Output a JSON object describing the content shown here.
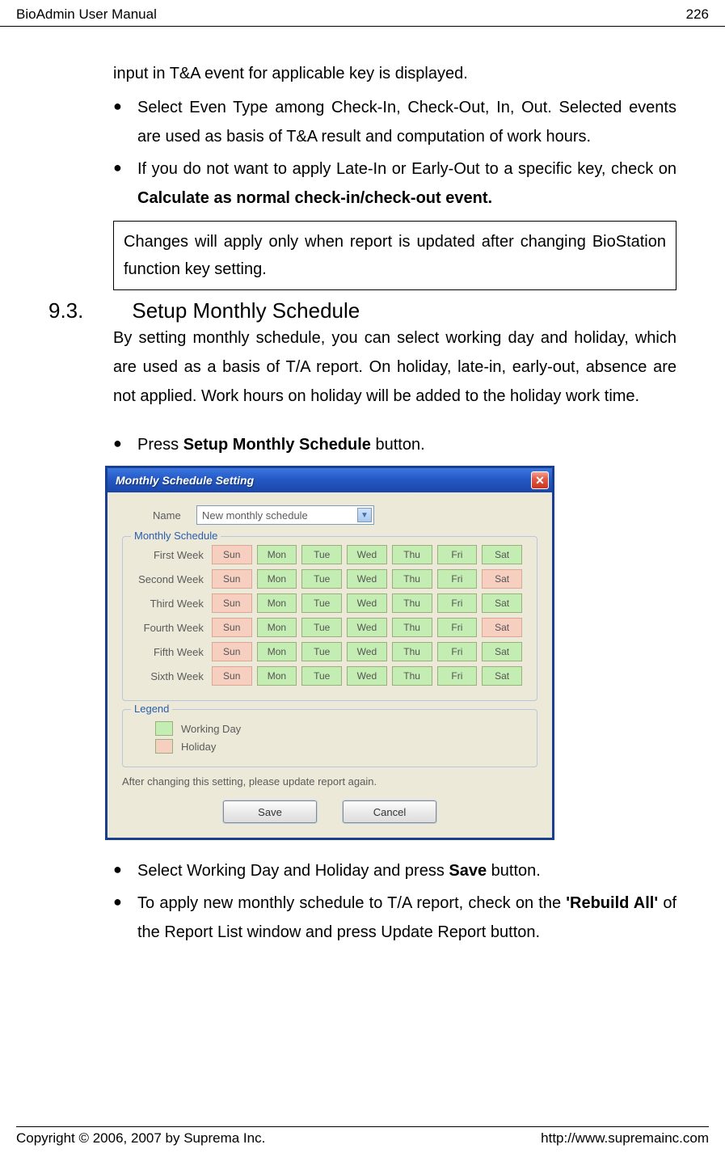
{
  "header": {
    "title": "BioAdmin User Manual",
    "page": "226"
  },
  "intro_text": "input in T&A event for applicable key is displayed.",
  "bullets_top": [
    {
      "text": "Select Even Type among Check-In, Check-Out, In, Out. Selected events are used as basis of T&A result and computation of work hours."
    },
    {
      "pre": "If you do not want to apply Late-In or Early-Out to a specific key, check on ",
      "bold": "Calculate as normal check-in/check-out event."
    }
  ],
  "note": "Changes will apply only when report is updated after changing BioStation function key setting.",
  "section": {
    "num": "9.3.",
    "title": "Setup Monthly Schedule"
  },
  "section_body": "By setting monthly schedule, you can select working day and holiday, which are used as a basis of T/A report. On holiday, late-in, early-out, absence are not applied. Work hours on holiday will be added to the holiday work time.",
  "bullet_press": {
    "pre": "Press ",
    "bold": "Setup Monthly Schedule",
    "post": " button."
  },
  "dialog": {
    "title": "Monthly Schedule Setting",
    "name_label": "Name",
    "combo_value": "New monthly schedule",
    "group_label": "Monthly Schedule",
    "days": [
      "Sun",
      "Mon",
      "Tue",
      "Wed",
      "Thu",
      "Fri",
      "Sat"
    ],
    "weeks": [
      {
        "label": "First Week",
        "pattern": [
          "holiday",
          "working",
          "working",
          "working",
          "working",
          "working",
          "working"
        ]
      },
      {
        "label": "Second Week",
        "pattern": [
          "holiday",
          "working",
          "working",
          "working",
          "working",
          "working",
          "holiday"
        ]
      },
      {
        "label": "Third Week",
        "pattern": [
          "holiday",
          "working",
          "working",
          "working",
          "working",
          "working",
          "working"
        ]
      },
      {
        "label": "Fourth Week",
        "pattern": [
          "holiday",
          "working",
          "working",
          "working",
          "working",
          "working",
          "holiday"
        ]
      },
      {
        "label": "Fifth Week",
        "pattern": [
          "holiday",
          "working",
          "working",
          "working",
          "working",
          "working",
          "working"
        ]
      },
      {
        "label": "Sixth Week",
        "pattern": [
          "holiday",
          "working",
          "working",
          "working",
          "working",
          "working",
          "working"
        ]
      }
    ],
    "legend_label": "Legend",
    "legend_working": "Working Day",
    "legend_holiday": "Holiday",
    "after_text": "After changing this setting, please update report again.",
    "save": "Save",
    "cancel": "Cancel"
  },
  "bullets_bottom": [
    {
      "pre": "Select Working Day and Holiday and press ",
      "bold": "Save",
      "post": " button."
    },
    {
      "pre": "To apply new monthly schedule to T/A report, check on the ",
      "bold": "'Rebuild All'",
      "post": " of the Report List window and press Update Report button."
    }
  ],
  "footer": {
    "copyright": "Copyright © 2006, 2007 by Suprema Inc.",
    "url": "http://www.supremainc.com"
  }
}
